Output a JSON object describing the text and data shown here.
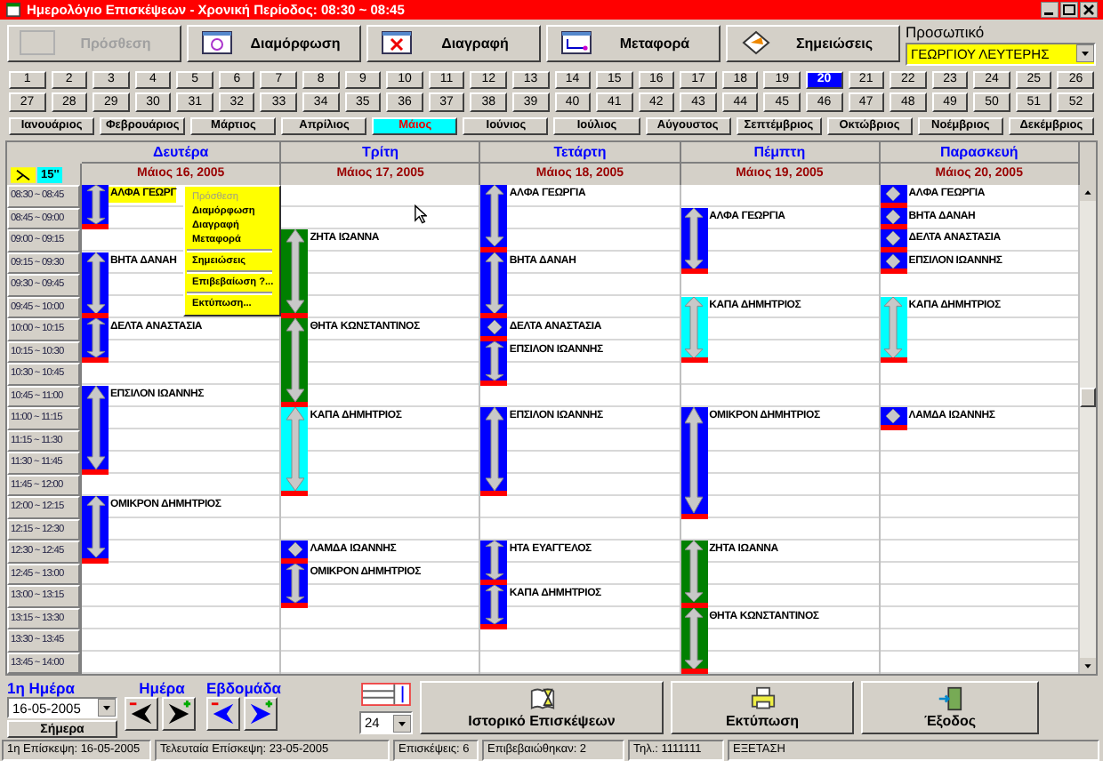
{
  "window": {
    "title": "Ημερολόγιο Επισκέψεων - Χρονική Περίοδος: 08:30 ~ 08:45"
  },
  "toolbar": [
    {
      "label": "Πρόσθεση",
      "disabled": true,
      "kind": "add"
    },
    {
      "label": "Διαμόρφωση",
      "disabled": false,
      "kind": "edit"
    },
    {
      "label": "Διαγραφή",
      "disabled": false,
      "kind": "delete"
    },
    {
      "label": "Μεταφορά",
      "disabled": false,
      "kind": "move"
    },
    {
      "label": "Σημειώσεις",
      "disabled": false,
      "kind": "notes"
    }
  ],
  "staff": {
    "label": "Προσωπικό",
    "value": "ΓΕΩΡΓΙΟΥ ΛΕΥΤΕΡΗΣ"
  },
  "weeks": [
    {
      "label": "1",
      "selected": false
    },
    {
      "label": "2",
      "selected": false
    },
    {
      "label": "3",
      "selected": false
    },
    {
      "label": "4",
      "selected": false
    },
    {
      "label": "5",
      "selected": false
    },
    {
      "label": "6",
      "selected": false
    },
    {
      "label": "7",
      "selected": false
    },
    {
      "label": "8",
      "selected": false
    },
    {
      "label": "9",
      "selected": false
    },
    {
      "label": "10",
      "selected": false
    },
    {
      "label": "11",
      "selected": false
    },
    {
      "label": "12",
      "selected": false
    },
    {
      "label": "13",
      "selected": false
    },
    {
      "label": "14",
      "selected": false
    },
    {
      "label": "15",
      "selected": false
    },
    {
      "label": "16",
      "selected": false
    },
    {
      "label": "17",
      "selected": false
    },
    {
      "label": "18",
      "selected": false
    },
    {
      "label": "19",
      "selected": false
    },
    {
      "label": "20",
      "selected": true
    },
    {
      "label": "21",
      "selected": false
    },
    {
      "label": "22",
      "selected": false
    },
    {
      "label": "23",
      "selected": false
    },
    {
      "label": "24",
      "selected": false
    },
    {
      "label": "25",
      "selected": false
    },
    {
      "label": "26",
      "selected": false
    },
    {
      "label": "27",
      "selected": false
    },
    {
      "label": "28",
      "selected": false
    },
    {
      "label": "29",
      "selected": false
    },
    {
      "label": "30",
      "selected": false
    },
    {
      "label": "31",
      "selected": false
    },
    {
      "label": "32",
      "selected": false
    },
    {
      "label": "33",
      "selected": false
    },
    {
      "label": "34",
      "selected": false
    },
    {
      "label": "35",
      "selected": false
    },
    {
      "label": "36",
      "selected": false
    },
    {
      "label": "37",
      "selected": false
    },
    {
      "label": "38",
      "selected": false
    },
    {
      "label": "39",
      "selected": false
    },
    {
      "label": "40",
      "selected": false
    },
    {
      "label": "41",
      "selected": false
    },
    {
      "label": "42",
      "selected": false
    },
    {
      "label": "43",
      "selected": false
    },
    {
      "label": "44",
      "selected": false
    },
    {
      "label": "45",
      "selected": false
    },
    {
      "label": "46",
      "selected": false
    },
    {
      "label": "47",
      "selected": false
    },
    {
      "label": "48",
      "selected": false
    },
    {
      "label": "49",
      "selected": false
    },
    {
      "label": "50",
      "selected": false
    },
    {
      "label": "51",
      "selected": false
    },
    {
      "label": "52",
      "selected": false
    }
  ],
  "months": [
    {
      "label": "Ιανουάριος",
      "selected": false
    },
    {
      "label": "Φεβρουάριος",
      "selected": false
    },
    {
      "label": "Μάρτιος",
      "selected": false
    },
    {
      "label": "Απρίλιος",
      "selected": false
    },
    {
      "label": "Μάιος",
      "selected": true
    },
    {
      "label": "Ιούνιος",
      "selected": false
    },
    {
      "label": "Ιούλιος",
      "selected": false
    },
    {
      "label": "Αύγουστος",
      "selected": false
    },
    {
      "label": "Σεπτέμβριος",
      "selected": false
    },
    {
      "label": "Οκτώβριος",
      "selected": false
    },
    {
      "label": "Νοέμβριος",
      "selected": false
    },
    {
      "label": "Δεκέμβριος",
      "selected": false
    }
  ],
  "interval": "15''",
  "times": [
    "08:30 ~ 08:45",
    "08:45 ~ 09:00",
    "09:00 ~ 09:15",
    "09:15 ~ 09:30",
    "09:30 ~ 09:45",
    "09:45 ~ 10:00",
    "10:00 ~ 10:15",
    "10:15 ~ 10:30",
    "10:30 ~ 10:45",
    "10:45 ~ 11:00",
    "11:00 ~ 11:15",
    "11:15 ~ 11:30",
    "11:30 ~ 11:45",
    "11:45 ~ 12:00",
    "12:00 ~ 12:15",
    "12:15 ~ 12:30",
    "12:30 ~ 12:45",
    "12:45 ~ 13:00",
    "13:00 ~ 13:15",
    "13:15 ~ 13:30",
    "13:30 ~ 13:45",
    "13:45 ~ 14:00"
  ],
  "days": [
    {
      "name": "Δευτέρα",
      "date": "Μάιος 16, 2005",
      "slots": [
        {
          "kind": "visit",
          "color": "#0000ff",
          "name": "ΑΛΦΑ ΓΕΩΡΓ",
          "selected": true
        },
        {
          "kind": "cont"
        },
        {
          "kind": "free"
        },
        {
          "kind": "visit",
          "color": "#0000ff",
          "name": "ΒΗΤΑ ΔΑΝΑΗ",
          "selected": false
        },
        {
          "kind": "cont"
        },
        {
          "kind": "cont"
        },
        {
          "kind": "visit",
          "color": "#0000ff",
          "name": "ΔΕΛΤΑ ΑΝΑΣΤΑΣΙΑ",
          "selected": false
        },
        {
          "kind": "cont"
        },
        {
          "kind": "free"
        },
        {
          "kind": "visit",
          "color": "#0000ff",
          "name": "ΕΠΣΙΛΟΝ ΙΩΑΝΝΗΣ",
          "selected": false
        },
        {
          "kind": "cont"
        },
        {
          "kind": "cont"
        },
        {
          "kind": "cont"
        },
        {
          "kind": "free"
        },
        {
          "kind": "visit",
          "color": "#0000ff",
          "name": "ΟΜΙΚΡΟΝ ΔΗΜΗΤΡΙΟΣ",
          "selected": false
        },
        {
          "kind": "cont"
        },
        {
          "kind": "cont"
        },
        {
          "kind": "free"
        },
        {
          "kind": "free"
        },
        {
          "kind": "free"
        },
        {
          "kind": "free"
        },
        {
          "kind": "free"
        }
      ]
    },
    {
      "name": "Τρίτη",
      "date": "Μάιος 17, 2005",
      "slots": [
        {
          "kind": "free"
        },
        {
          "kind": "free"
        },
        {
          "kind": "visit",
          "color": "#008000",
          "name": "ΖΗΤΑ ΙΩΑΝΝΑ",
          "selected": false
        },
        {
          "kind": "cont"
        },
        {
          "kind": "cont"
        },
        {
          "kind": "cont"
        },
        {
          "kind": "visit",
          "color": "#008000",
          "name": "ΘΗΤΑ ΚΩΝΣΤΑΝΤΙΝΟΣ",
          "selected": false
        },
        {
          "kind": "cont"
        },
        {
          "kind": "cont"
        },
        {
          "kind": "cont"
        },
        {
          "kind": "visit",
          "color": "#00ffff",
          "name": "ΚΑΠΑ ΔΗΜΗΤΡΙΟΣ",
          "selected": false
        },
        {
          "kind": "cont"
        },
        {
          "kind": "cont"
        },
        {
          "kind": "cont"
        },
        {
          "kind": "free"
        },
        {
          "kind": "free"
        },
        {
          "kind": "visit",
          "color": "#0000ff",
          "name": "ΛΑΜΔΑ ΙΩΑΝΝΗΣ",
          "selected": false
        },
        {
          "kind": "visit",
          "color": "#0000ff",
          "name": "ΟΜΙΚΡΟΝ ΔΗΜΗΤΡΙΟΣ",
          "selected": false
        },
        {
          "kind": "cont"
        },
        {
          "kind": "free"
        },
        {
          "kind": "free"
        },
        {
          "kind": "free"
        }
      ]
    },
    {
      "name": "Τετάρτη",
      "date": "Μάιος 18, 2005",
      "slots": [
        {
          "kind": "visit",
          "color": "#0000ff",
          "name": "ΑΛΦΑ ΓΕΩΡΓΙΑ",
          "selected": false
        },
        {
          "kind": "cont"
        },
        {
          "kind": "cont"
        },
        {
          "kind": "visit",
          "color": "#0000ff",
          "name": "ΒΗΤΑ ΔΑΝΑΗ",
          "selected": false
        },
        {
          "kind": "cont"
        },
        {
          "kind": "cont"
        },
        {
          "kind": "visit",
          "color": "#0000ff",
          "name": "ΔΕΛΤΑ ΑΝΑΣΤΑΣΙΑ",
          "selected": false
        },
        {
          "kind": "visit",
          "color": "#0000ff",
          "name": "ΕΠΣΙΛΟΝ ΙΩΑΝΝΗΣ",
          "selected": false
        },
        {
          "kind": "cont"
        },
        {
          "kind": "free"
        },
        {
          "kind": "visit",
          "color": "#0000ff",
          "name": "ΕΠΣΙΛΟΝ ΙΩΑΝΝΗΣ",
          "selected": false
        },
        {
          "kind": "cont"
        },
        {
          "kind": "cont"
        },
        {
          "kind": "cont"
        },
        {
          "kind": "free"
        },
        {
          "kind": "free"
        },
        {
          "kind": "visit",
          "color": "#0000ff",
          "name": "ΗΤΑ ΕΥΑΓΓΕΛΟΣ",
          "selected": false
        },
        {
          "kind": "cont"
        },
        {
          "kind": "visit",
          "color": "#0000ff",
          "name": "ΚΑΠΑ ΔΗΜΗΤΡΙΟΣ",
          "selected": false
        },
        {
          "kind": "cont"
        },
        {
          "kind": "free"
        },
        {
          "kind": "free"
        }
      ]
    },
    {
      "name": "Πέμπτη",
      "date": "Μάιος 19, 2005",
      "slots": [
        {
          "kind": "free"
        },
        {
          "kind": "visit",
          "color": "#0000ff",
          "name": "ΑΛΦΑ ΓΕΩΡΓΙΑ",
          "selected": false
        },
        {
          "kind": "cont"
        },
        {
          "kind": "cont"
        },
        {
          "kind": "free"
        },
        {
          "kind": "visit",
          "color": "#00ffff",
          "name": "ΚΑΠΑ ΔΗΜΗΤΡΙΟΣ",
          "selected": false
        },
        {
          "kind": "cont"
        },
        {
          "kind": "cont"
        },
        {
          "kind": "free"
        },
        {
          "kind": "free"
        },
        {
          "kind": "visit",
          "color": "#0000ff",
          "name": "ΟΜΙΚΡΟΝ ΔΗΜΗΤΡΙΟΣ",
          "selected": false
        },
        {
          "kind": "cont"
        },
        {
          "kind": "cont"
        },
        {
          "kind": "cont"
        },
        {
          "kind": "cont"
        },
        {
          "kind": "free"
        },
        {
          "kind": "visit",
          "color": "#008000",
          "name": "ΖΗΤΑ ΙΩΑΝΝΑ",
          "selected": false
        },
        {
          "kind": "cont"
        },
        {
          "kind": "cont"
        },
        {
          "kind": "visit",
          "color": "#008000",
          "name": "ΘΗΤΑ ΚΩΝΣΤΑΝΤΙΝΟΣ",
          "selected": false
        },
        {
          "kind": "cont"
        },
        {
          "kind": "cont"
        }
      ]
    },
    {
      "name": "Παρασκευή",
      "date": "Μάιος 20, 2005",
      "slots": [
        {
          "kind": "visit",
          "color": "#0000ff",
          "name": "ΑΛΦΑ ΓΕΩΡΓΙΑ",
          "selected": false
        },
        {
          "kind": "visit",
          "color": "#0000ff",
          "name": "ΒΗΤΑ ΔΑΝΑΗ",
          "selected": false
        },
        {
          "kind": "visit",
          "color": "#0000ff",
          "name": "ΔΕΛΤΑ ΑΝΑΣΤΑΣΙΑ",
          "selected": false
        },
        {
          "kind": "visit",
          "color": "#0000ff",
          "name": "ΕΠΣΙΛΟΝ ΙΩΑΝΝΗΣ",
          "selected": false
        },
        {
          "kind": "free"
        },
        {
          "kind": "visit",
          "color": "#00ffff",
          "name": "ΚΑΠΑ ΔΗΜΗΤΡΙΟΣ",
          "selected": false
        },
        {
          "kind": "cont"
        },
        {
          "kind": "cont"
        },
        {
          "kind": "free"
        },
        {
          "kind": "free"
        },
        {
          "kind": "visit",
          "color": "#0000ff",
          "name": "ΛΑΜΔΑ ΙΩΑΝΝΗΣ",
          "selected": false
        },
        {
          "kind": "free"
        },
        {
          "kind": "free"
        },
        {
          "kind": "free"
        },
        {
          "kind": "free"
        },
        {
          "kind": "free"
        },
        {
          "kind": "free"
        },
        {
          "kind": "free"
        },
        {
          "kind": "free"
        },
        {
          "kind": "free"
        },
        {
          "kind": "free"
        },
        {
          "kind": "free"
        }
      ]
    }
  ],
  "context_menu": [
    {
      "label": "Πρόσθεση",
      "disabled": true,
      "separator_before": false
    },
    {
      "label": "Διαμόρφωση",
      "disabled": false,
      "separator_before": false
    },
    {
      "label": "Διαγραφή",
      "disabled": false,
      "separator_before": false
    },
    {
      "label": "Μεταφορά",
      "disabled": false,
      "separator_before": false
    },
    {
      "label": "Σημειώσεις",
      "disabled": false,
      "separator_before": true
    },
    {
      "label": "Επιβεβαίωση ?...",
      "disabled": false,
      "separator_before": true
    },
    {
      "label": "Εκτύπωση...",
      "disabled": false,
      "separator_before": true
    }
  ],
  "navigation": {
    "first_day_label": "1η Ημέρα",
    "first_day": "16-05-2005",
    "today": "Σήμερα",
    "day_label": "Ημέρα",
    "week_label": "Εβδομάδα",
    "rows": "24"
  },
  "actions": [
    {
      "label": "Ιστορικό Επισκέψεων",
      "kind": "history"
    },
    {
      "label": "Εκτύπωση",
      "kind": "print"
    },
    {
      "label": "Έξοδος",
      "kind": "exit"
    }
  ],
  "status_bar": [
    "1η Επίσκεψη: 16-05-2005",
    "Τελευταία Επίσκεψη: 23-05-2005",
    "Επισκέψεις: 6",
    "Επιβεβαιώθηκαν: 2",
    "Τηλ.: 1111111",
    "ΕΞΕΤΑΣΗ"
  ]
}
